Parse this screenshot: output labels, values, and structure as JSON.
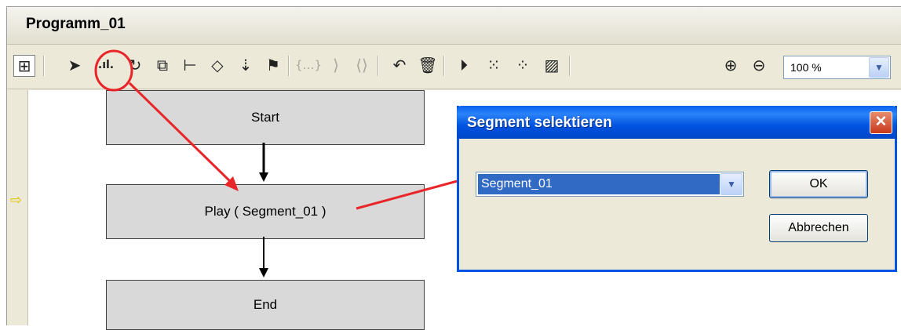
{
  "window": {
    "title": "Programm_01"
  },
  "toolbar": {
    "zoom_value": "100 %",
    "icons": [
      "diagram-icon",
      "pointer-icon",
      "segment-icon",
      "loop-icon",
      "subprogram-icon",
      "branch-icon",
      "decision-icon",
      "merge-icon",
      "flag-icon",
      "braces-icon",
      "bracket-right-icon",
      "bracket-both-icon",
      "undo-icon",
      "delete-icon",
      "step-icon",
      "group-icon",
      "ungroup-icon",
      "image-icon",
      "zoom-in-icon",
      "zoom-out-icon"
    ]
  },
  "flow": {
    "start": "Start",
    "play": "Play ( Segment_01 )",
    "end": "End"
  },
  "dialog": {
    "title": "Segment selektieren",
    "selected": "Segment_01",
    "ok": "OK",
    "cancel": "Abbrechen",
    "close_glyph": "✕"
  },
  "colors": {
    "annotation": "#e8262a",
    "dialog_title": "#0054e3",
    "selection": "#316ac5"
  }
}
